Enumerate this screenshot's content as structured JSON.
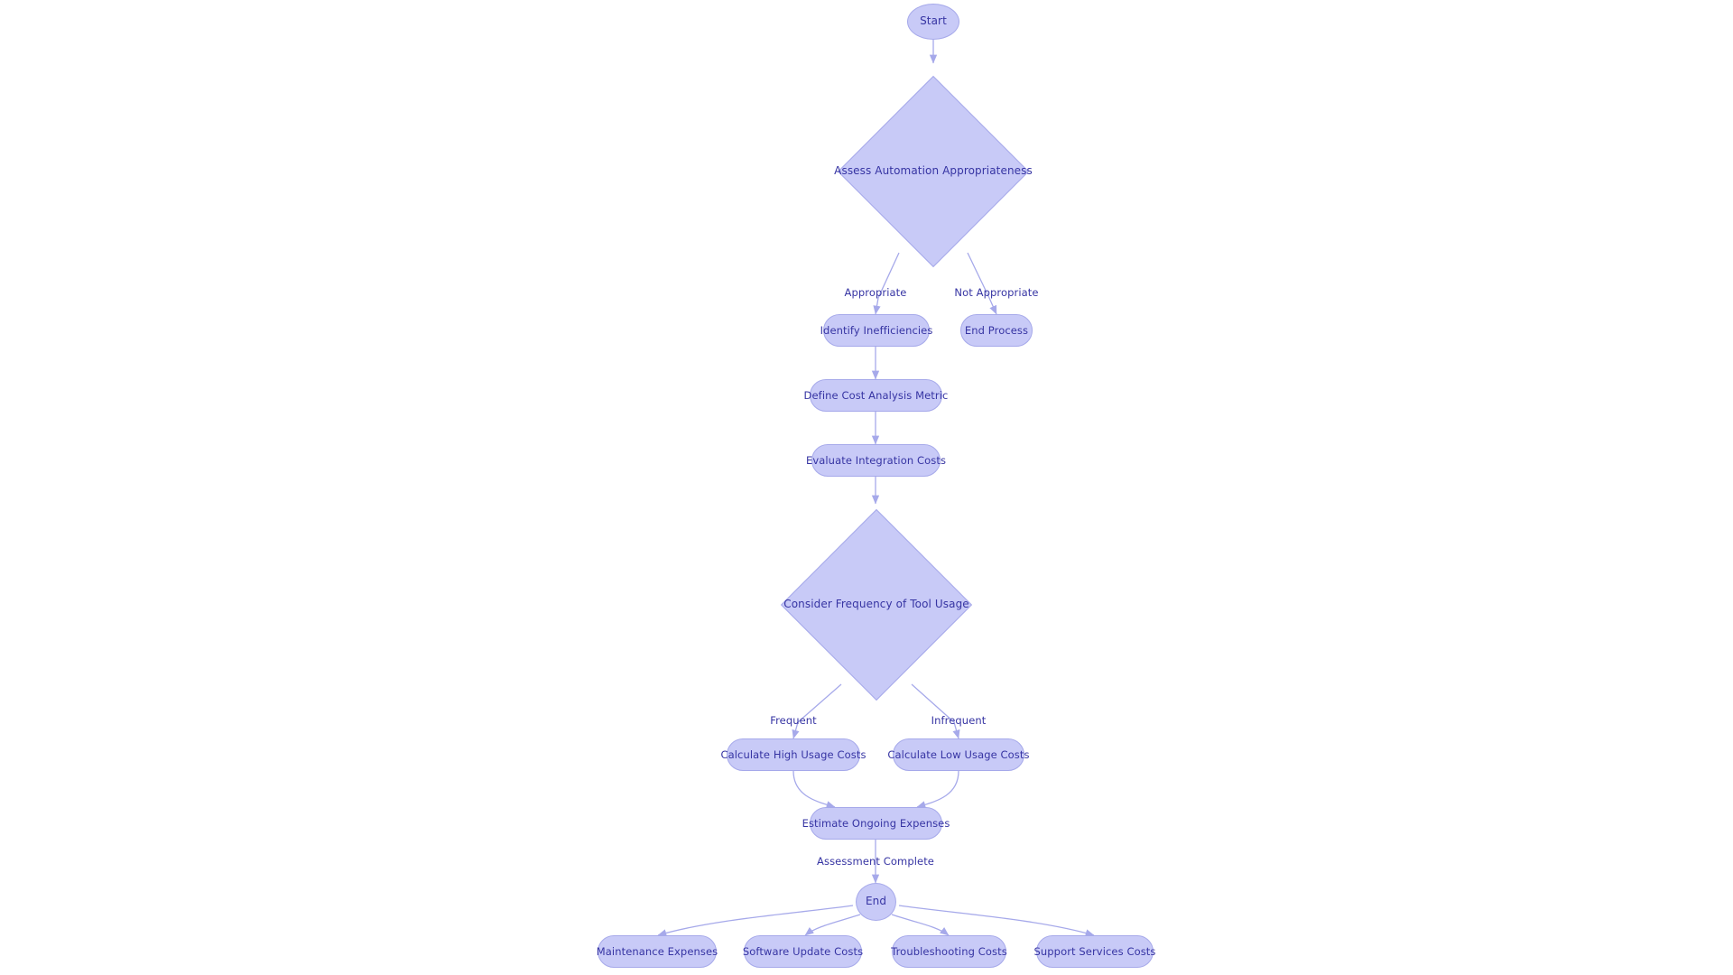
{
  "diagram": {
    "type": "flowchart",
    "title": "Automation Cost Assessment Flowchart",
    "orientation": "top-to-bottom",
    "theme": {
      "node_fill": "#c8caf7",
      "node_border": "#a6a9ea",
      "text_color": "#3634a3",
      "edge_color": "#a6a9ea",
      "background": "#ffffff"
    }
  },
  "nodes": {
    "start": {
      "label": "Start",
      "shape": "ellipse"
    },
    "assess": {
      "label": "Assess Automation Appropriateness",
      "shape": "diamond"
    },
    "identify": {
      "label": "Identify Inefficiencies",
      "shape": "rounded-rect"
    },
    "end_process": {
      "label": "End Process",
      "shape": "rounded-rect"
    },
    "define_metric": {
      "label": "Define Cost Analysis Metric",
      "shape": "rounded-rect"
    },
    "evaluate_integration": {
      "label": "Evaluate Integration Costs",
      "shape": "rounded-rect"
    },
    "frequency": {
      "label": "Consider Frequency of Tool Usage",
      "shape": "diamond"
    },
    "high_usage": {
      "label": "Calculate High Usage Costs",
      "shape": "rounded-rect"
    },
    "low_usage": {
      "label": "Calculate Low Usage Costs",
      "shape": "rounded-rect"
    },
    "ongoing": {
      "label": "Estimate Ongoing Expenses",
      "shape": "rounded-rect"
    },
    "end": {
      "label": "End",
      "shape": "ellipse"
    },
    "maintenance": {
      "label": "Maintenance Expenses",
      "shape": "rounded-rect"
    },
    "software_update": {
      "label": "Software Update Costs",
      "shape": "rounded-rect"
    },
    "troubleshooting": {
      "label": "Troubleshooting Costs",
      "shape": "rounded-rect"
    },
    "support_services": {
      "label": "Support Services Costs",
      "shape": "rounded-rect"
    }
  },
  "edge_labels": {
    "appropriate": "Appropriate",
    "not_appropriate": "Not Appropriate",
    "frequent": "Frequent",
    "infrequent": "Infrequent",
    "assessment_complete": "Assessment Complete"
  },
  "edges": [
    {
      "from": "start",
      "to": "assess",
      "label": ""
    },
    {
      "from": "assess",
      "to": "identify",
      "label": "Appropriate"
    },
    {
      "from": "assess",
      "to": "end_process",
      "label": "Not Appropriate"
    },
    {
      "from": "identify",
      "to": "define_metric",
      "label": ""
    },
    {
      "from": "define_metric",
      "to": "evaluate_integration",
      "label": ""
    },
    {
      "from": "evaluate_integration",
      "to": "frequency",
      "label": ""
    },
    {
      "from": "frequency",
      "to": "high_usage",
      "label": "Frequent"
    },
    {
      "from": "frequency",
      "to": "low_usage",
      "label": "Infrequent"
    },
    {
      "from": "high_usage",
      "to": "ongoing",
      "label": ""
    },
    {
      "from": "low_usage",
      "to": "ongoing",
      "label": ""
    },
    {
      "from": "ongoing",
      "to": "end",
      "label": "Assessment Complete"
    },
    {
      "from": "end",
      "to": "maintenance",
      "label": ""
    },
    {
      "from": "end",
      "to": "software_update",
      "label": ""
    },
    {
      "from": "end",
      "to": "troubleshooting",
      "label": ""
    },
    {
      "from": "end",
      "to": "support_services",
      "label": ""
    }
  ]
}
